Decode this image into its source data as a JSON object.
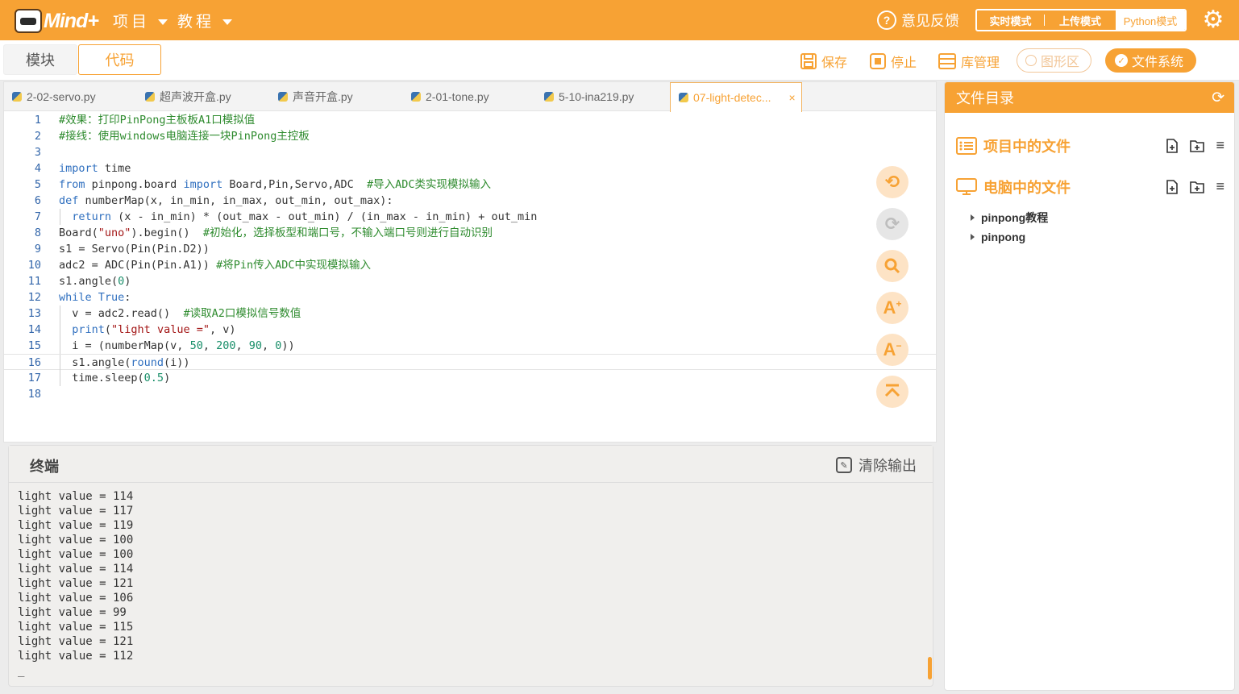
{
  "header": {
    "logo_text": "Mind+",
    "menu_project": "项目",
    "menu_tutorial": "教程",
    "feedback": "意见反馈",
    "mode_realtime": "实时模式",
    "mode_upload": "上传模式",
    "mode_python": "Python模式"
  },
  "subbar": {
    "tab_blocks": "模块",
    "tab_code": "代码",
    "save": "保存",
    "stop": "停止",
    "library": "库管理",
    "graphics": "图形区",
    "filesystem": "文件系统"
  },
  "file_tabs": [
    {
      "label": "2-02-servo.py"
    },
    {
      "label": "超声波开盒.py"
    },
    {
      "label": "声音开盒.py"
    },
    {
      "label": "2-01-tone.py"
    },
    {
      "label": "5-10-ina219.py"
    },
    {
      "label": "07-light-detec...",
      "close": "×"
    }
  ],
  "code_lines": [
    {
      "n": "1",
      "code": "#效果：打印PinPong主板板A1口模拟值"
    },
    {
      "n": "2",
      "code": "#接线：使用windows电脑连接一块PinPong主控板"
    },
    {
      "n": "3",
      "code": ""
    },
    {
      "n": "4",
      "code": "import time"
    },
    {
      "n": "5",
      "code": "from pinpong.board import Board,Pin,Servo,ADC  #导入ADC类实现模拟输入"
    },
    {
      "n": "6",
      "code": "def numberMap(x, in_min, in_max, out_min, out_max):"
    },
    {
      "n": "7",
      "code": "  return (x - in_min) * (out_max - out_min) / (in_max - in_min) + out_min"
    },
    {
      "n": "8",
      "code": "Board(\"uno\").begin()  #初始化，选择板型和端口号，不输入端口号则进行自动识别"
    },
    {
      "n": "9",
      "code": "s1 = Servo(Pin(Pin.D2))"
    },
    {
      "n": "10",
      "code": "adc2 = ADC(Pin(Pin.A1)) #将Pin传入ADC中实现模拟输入"
    },
    {
      "n": "11",
      "code": "s1.angle(0)"
    },
    {
      "n": "12",
      "code": "while True:"
    },
    {
      "n": "13",
      "code": "  v = adc2.read()  #读取A2口模拟信号数值"
    },
    {
      "n": "14",
      "code": "  print(\"light value =\", v)"
    },
    {
      "n": "15",
      "code": "  i = (numberMap(v, 50, 200, 90, 0))"
    },
    {
      "n": "16",
      "code": "  s1.angle(round(i))"
    },
    {
      "n": "17",
      "code": "  time.sleep(0.5)"
    },
    {
      "n": "18",
      "code": ""
    }
  ],
  "terminal": {
    "title": "终端",
    "clear": "清除输出",
    "lines": [
      "light value = 114",
      "light value = 117",
      "light value = 119",
      "light value = 100",
      "light value = 100",
      "light value = 114",
      "light value = 121",
      "light value = 106",
      "light value = 99",
      "light value = 115",
      "light value = 121",
      "light value = 112",
      "_"
    ]
  },
  "file_panel": {
    "title": "文件目录",
    "project_files": "项目中的文件",
    "computer_files": "电脑中的文件",
    "tree": [
      {
        "label": "pinpong教程"
      },
      {
        "label": "pinpong"
      }
    ]
  },
  "colors": {
    "accent": "#f7a234"
  }
}
